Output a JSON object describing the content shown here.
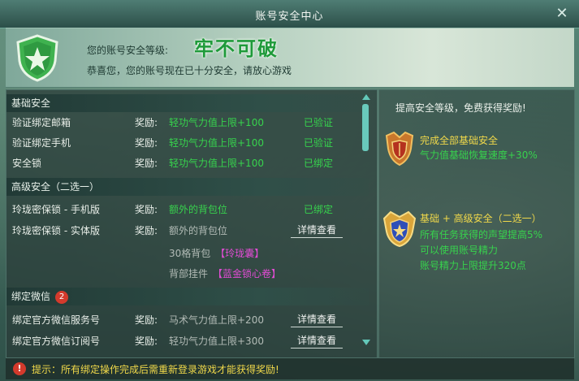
{
  "window": {
    "title": "账号安全中心",
    "close_icon": "close-icon"
  },
  "banner": {
    "security_level_label": "您的账号安全等级:",
    "security_level_value": "牢不可破",
    "description": "恭喜您，您的账号现在已十分安全，请放心游戏"
  },
  "sections": {
    "basic": {
      "title": "基础安全",
      "rows": [
        {
          "name": "验证绑定邮箱",
          "reward_label": "奖励:",
          "reward": "轻功气力值上限+100",
          "status": "已验证"
        },
        {
          "name": "验证绑定手机",
          "reward_label": "奖励:",
          "reward": "轻功气力值上限+100",
          "status": "已验证"
        },
        {
          "name": "安全锁",
          "reward_label": "奖励:",
          "reward": "轻功气力值上限+100",
          "status": "已绑定"
        }
      ]
    },
    "advanced": {
      "title": "高级安全（二选一）",
      "rows": [
        {
          "name": "玲珑密保锁 - 手机版",
          "reward_label": "奖励:",
          "reward": "额外的背包位",
          "status": "已绑定"
        },
        {
          "name": "玲珑密保锁 - 实体版",
          "reward_label": "奖励:",
          "reward": "额外的背包位",
          "button": "详情查看"
        }
      ],
      "subitems": [
        {
          "text": "30格背包",
          "link": "【玲珑囊】"
        },
        {
          "text": "背部挂件",
          "link": "【蓝金锁心卷】"
        }
      ]
    },
    "wechat": {
      "title": "绑定微信",
      "badge": "2",
      "rows": [
        {
          "name": "绑定官方微信服务号",
          "reward_label": "奖励:",
          "reward": "马术气力值上限+200",
          "button": "详情查看"
        },
        {
          "name": "绑定官方微信订阅号",
          "reward_label": "奖励:",
          "reward": "轻功气力值上限+300",
          "button": "详情查看"
        }
      ]
    }
  },
  "right_panel": {
    "title": "提高安全等级，免费获得奖励!",
    "rewards": [
      {
        "title": "完成全部基础安全",
        "lines": [
          "气力值基础恢复速度+30%"
        ],
        "icon": "bronze-shield-medal-icon"
      },
      {
        "title": "基础 + 高级安全（二选一）",
        "lines": [
          "所有任务获得的声望提高5%",
          "可以使用账号精力",
          "账号精力上限提升320点"
        ],
        "icon": "blue-shield-medal-icon"
      }
    ]
  },
  "tip": {
    "icon": "!",
    "text": "提示：所有绑定操作完成后需重新登录游戏才能获得奖励!"
  },
  "colors": {
    "accent_green": "#37d24d",
    "gold": "#f0d84a",
    "link_magenta": "#e24cd5",
    "badge_red": "#d33a2c"
  }
}
